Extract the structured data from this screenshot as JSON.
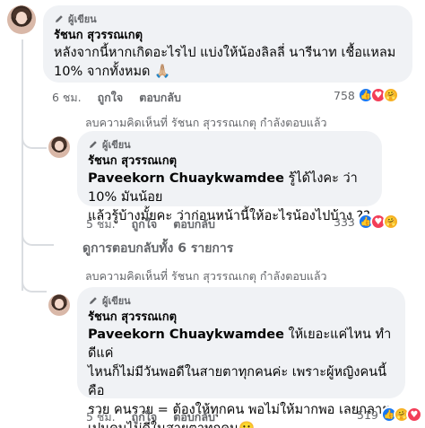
{
  "comment1": {
    "badge": "ผู้เขียน",
    "author": "รัชนก สุวรรณเกตุ",
    "text_line1": "หลังจากนี้หากเกิดอะไรไป แบ่งให้น้องลิลลี่ นารีนาท เชื้อแหลม",
    "text_line2": "10% จากทั้งหมด 🙏🏼",
    "time": "6 ชม.",
    "like": "ถูกใจ",
    "reply": "ตอบกลับ",
    "reaction_count": "758"
  },
  "deleted1": "ลบความคิดเห็นที่ รัชนก สุวรรณเกตุ กำลังตอบแล้ว",
  "comment2": {
    "badge": "ผู้เขียน",
    "author": "รัชนก สุวรรณเกตุ",
    "mention": "Paveekorn Chuaykwamdee",
    "text_line1_rest": " รู้ได้ไงคะ ว่า 10% มันน้อย",
    "text_line2": "แล้วรู้บ้างมั้ยคะ ว่าก่อนหน้านี้ให้อะไรน้องไปบ้าง ??",
    "time": "5 ชม.",
    "like": "ถูกใจ",
    "reply": "ตอบกลับ",
    "reaction_count": "333"
  },
  "view_replies": "ดูการตอบกลับทั้ง 6 รายการ",
  "deleted2": "ลบความคิดเห็นที่ รัชนก สุวรรณเกตุ กำลังตอบแล้ว",
  "comment3": {
    "badge": "ผู้เขียน",
    "author": "รัชนก สุวรรณเกตุ",
    "mention": "Paveekorn Chuaykwamdee",
    "text_line1_rest": " ให้เยอะแค่ไหน ทำดีแค่",
    "text_line2": "ไหนก็ไม่มีวันพอดีในสายตาทุกคนค่ะ เพราะผู้หญิงคนนี้คือ",
    "text_line3": "รวย คนรวย = ต้องให้ทุกคน พอไม่ให้มากพอ เลยกลาย",
    "text_line4": "เปนคนไม่ดีในสายตาทุกคน🙂",
    "time": "5 ชม.",
    "like": "ถูกใจ",
    "reply": "ตอบกลับ",
    "reaction_count": "519"
  },
  "colors": {
    "like_blue": "#1877f2",
    "love_red": "#f33e58",
    "care_yellow": "#f7b125",
    "bubble_bg": "#f0f2f5",
    "muted": "#65676b"
  },
  "icons": {
    "badge": "pen-icon",
    "reactions": [
      "like-icon",
      "love-icon",
      "care-icon"
    ]
  }
}
